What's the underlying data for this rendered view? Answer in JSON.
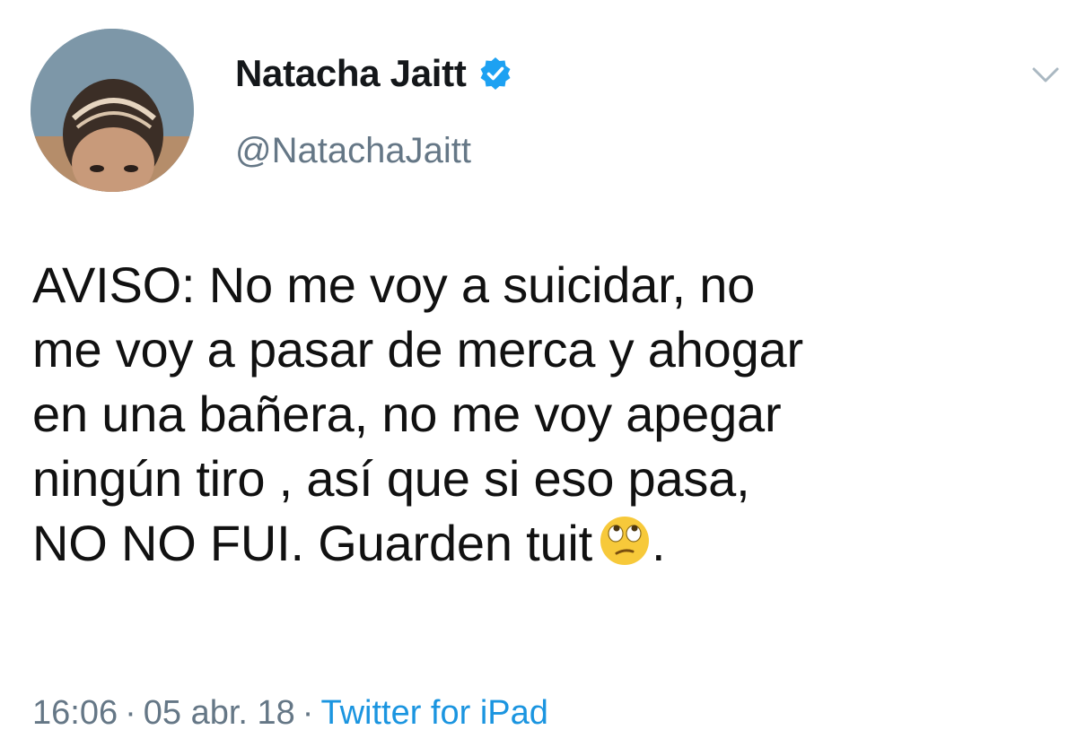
{
  "tweet": {
    "author": {
      "display_name": "Natacha Jaitt",
      "handle": "@NatachaJaitt",
      "verified": true
    },
    "text_lines": [
      "AVISO: No me voy a suicidar, no",
      "me voy a pasar de merca y ahogar",
      "en una bañera, no me voy apegar",
      "ningún tiro , así que si eso pasa,",
      "NO NO FUI. Guarden tuit"
    ],
    "text_end": ".",
    "emoji": "face-with-rolling-eyes-icon",
    "time": "16:06",
    "separator": "·",
    "date": "05 abr. 18",
    "source": "Twitter for iPad"
  },
  "colors": {
    "verified_blue": "#1da1f2",
    "muted_gray": "#657786",
    "link_blue": "#1b95e0"
  }
}
